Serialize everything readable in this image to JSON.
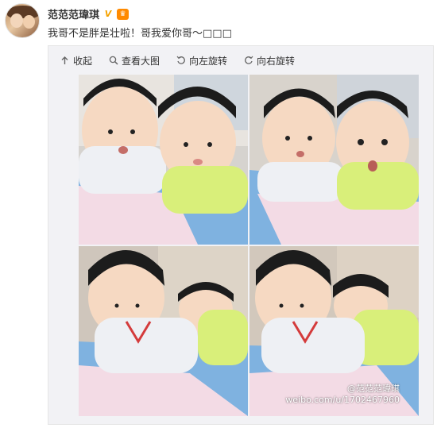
{
  "user": {
    "name": "范范范瑋琪",
    "verified_badge": "V",
    "crown_badge": "♛"
  },
  "post": {
    "text": "我哥不是胖是壮啦！哥我爱你哥～□□□"
  },
  "toolbar": {
    "collapse_label": "收起",
    "view_large_label": "查看大图",
    "rotate_left_label": "向左旋转",
    "rotate_right_label": "向右旋转",
    "icons": [
      "arrow-up-icon",
      "magnifier-icon",
      "rotate-left-icon",
      "rotate-right-icon"
    ]
  },
  "photos": [
    {
      "alt": "two babies on play mat, one looking up, one looking at camera"
    },
    {
      "alt": "two babies on play mat, baby in yellow surprised"
    },
    {
      "alt": "baby in white shirt crawling, baby in yellow behind"
    },
    {
      "alt": "baby in white shirt looking down, baby in yellow hugging"
    }
  ],
  "watermark": {
    "handle": "@范范范瑋琪",
    "url": "weibo.com/u/1702467960"
  },
  "colors": {
    "mat_blue": "#7fb2e0",
    "mat_pink": "#f3dbe5",
    "shirt_yellow": "#d9ef7a",
    "shirt_white": "#eef0f4",
    "skin": "#f6d9c2",
    "hair": "#1c1c1c"
  }
}
